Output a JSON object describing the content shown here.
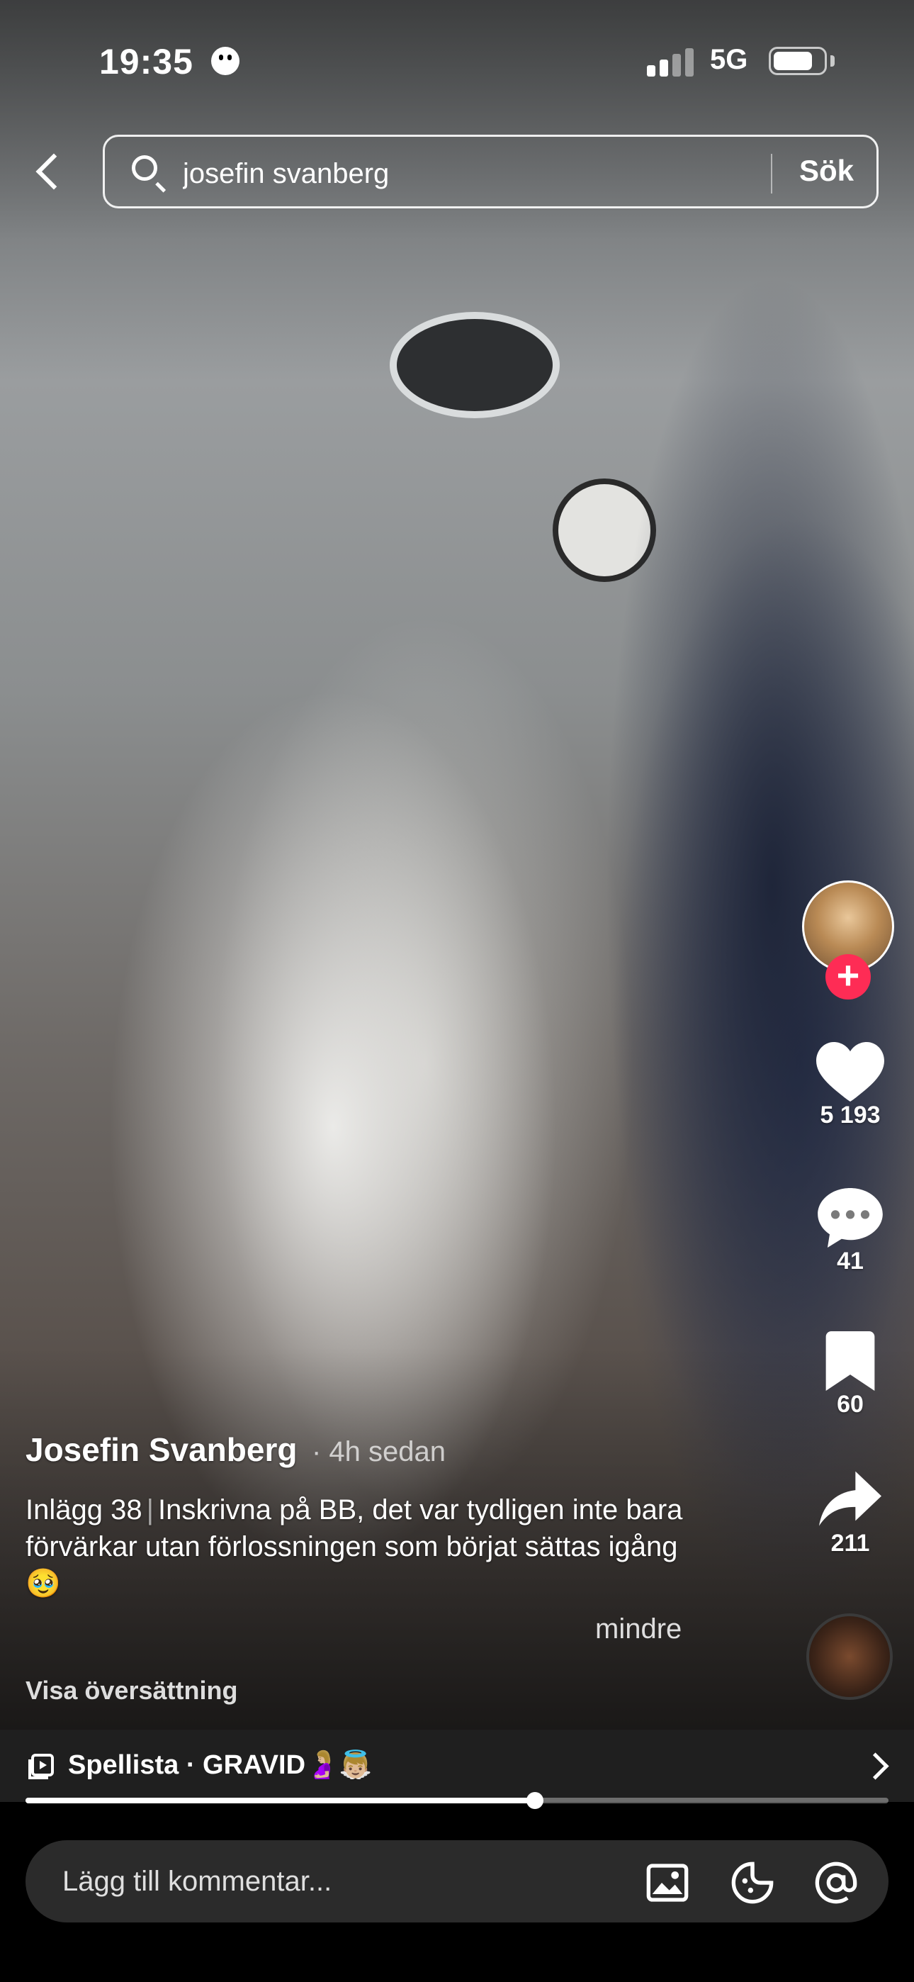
{
  "status_bar": {
    "time": "19:35",
    "network": "5G",
    "battery_level": 0.8
  },
  "search": {
    "query": "josefin svanberg",
    "submit_label": "Sök"
  },
  "actions": {
    "likes": "5 193",
    "comments": "41",
    "saves": "60",
    "shares": "211",
    "follow_symbol": "+",
    "like_color": "#ffffff",
    "follow_color": "#fe2c55"
  },
  "post": {
    "author": "Josefin Svanberg",
    "time_ago": "· 4h sedan",
    "caption_part1": "Inlägg 38",
    "caption_separator": "|",
    "caption_part2": "Inskrivna på BB, det var tydligen inte bara förvärkar utan förlossningen som börjat sättas igång🥹",
    "less_label": "mindre",
    "translate_label": "Visa översättning"
  },
  "playlist": {
    "label": "Spellista · GRAVID🤰🏼👼🏼"
  },
  "playback": {
    "progress": 0.59
  },
  "comment_bar": {
    "placeholder": "Lägg till kommentar..."
  }
}
